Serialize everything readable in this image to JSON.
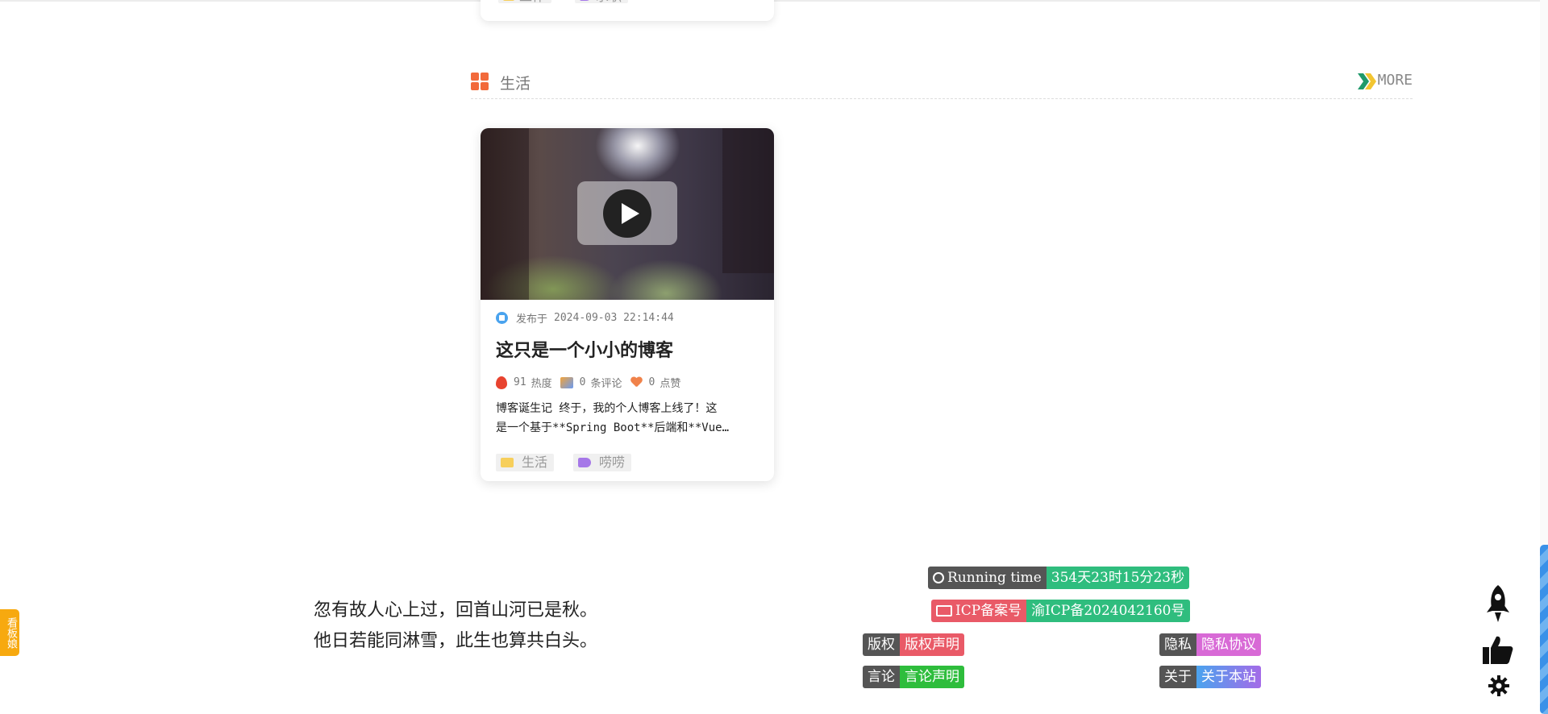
{
  "prev_card": {
    "category": "工作",
    "tag": "求职"
  },
  "section": {
    "title": "生活",
    "more_label": "MORE"
  },
  "article": {
    "published_label": "发布于",
    "published_at": "2024-09-03 22:14:44",
    "title": "这只是一个小小的博客",
    "heat_value": "91",
    "heat_label": "热度",
    "comments_value": "0",
    "comments_label": "条评论",
    "likes_value": "0",
    "likes_label": "点赞",
    "excerpt_line1": "博客诞生记 终于，我的个人博客上线了！这",
    "excerpt_line2": "是一个基于**Spring Boot**后端和**Vue…",
    "category": "生活",
    "tag": "唠唠"
  },
  "poem": {
    "line1": "忽有故人心上过，回首山河已是秋。",
    "line2": "他日若能同淋雪，此生也算共白头。"
  },
  "footer": {
    "running_label": "Running time",
    "running_value": "354天23时15分23秒",
    "icp_label": "ICP备案号",
    "icp_value": "渝ICP备2024042160号",
    "copyright_label": "版权",
    "copyright_value": "版权声明",
    "privacy_label": "隐私",
    "privacy_value": "隐私协议",
    "speech_label": "言论",
    "speech_value": "言论声明",
    "about_label": "关于",
    "about_value": "关于本站"
  },
  "mascot_tab": "看板娘",
  "colors": {
    "running_value_bg": "#2fbd7e",
    "icp_label_bg": "#e95a67",
    "icp_value_bg": "#2fbd7e",
    "copyright_value_bg": "#e95a67",
    "privacy_value_bg": "#d86ad6",
    "speech_value_bg": "#2ebd3c",
    "about_value_bg_start": "#4aa3ee",
    "about_value_bg_end": "#a46be8",
    "section_icon": "#f26a3b",
    "mascot_tab_bg": "#f7a90f"
  }
}
